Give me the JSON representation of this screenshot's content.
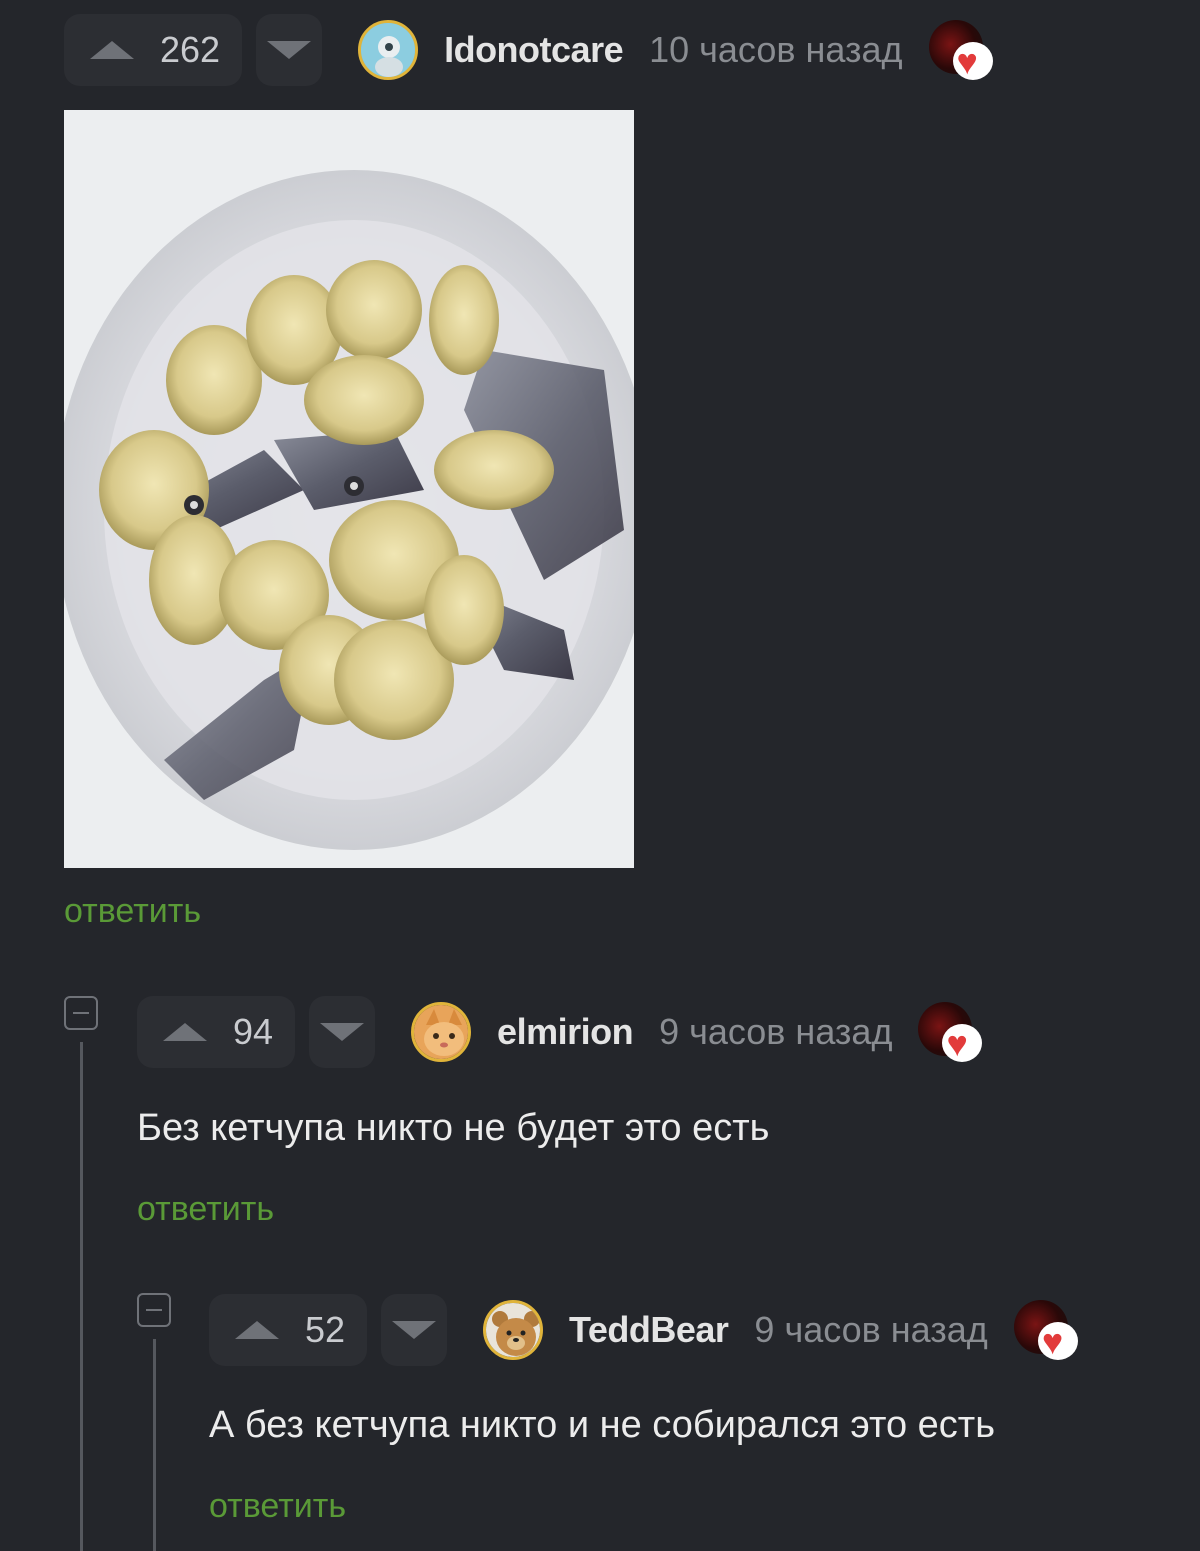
{
  "comments": [
    {
      "votes": "262",
      "username": "Idonotcare",
      "time": "10 часов назад",
      "reply_label": "ответить"
    },
    {
      "votes": "94",
      "username": "elmirion",
      "time": "9 часов назад",
      "text": "Без кетчупа никто не будет это есть",
      "reply_label": "ответить"
    },
    {
      "votes": "52",
      "username": "TeddBear",
      "time": "9 часов назад",
      "text": "А без кетчупа никто и не собирался это есть",
      "reply_label": "ответить"
    }
  ],
  "colors": {
    "background": "#24262b",
    "reply": "#5a9a37",
    "badge_heart": "#e23b3b"
  }
}
